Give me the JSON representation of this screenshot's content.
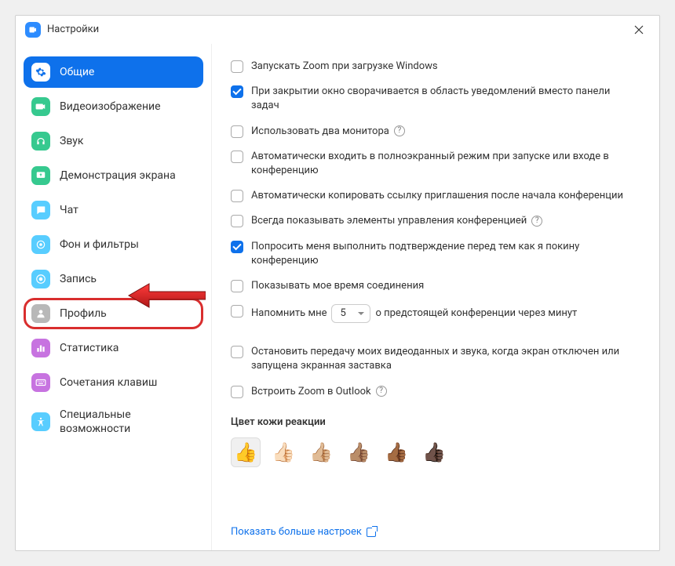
{
  "window": {
    "title": "Настройки"
  },
  "sidebar": {
    "items": [
      {
        "id": "general",
        "label": "Общие",
        "iconClass": "ic-general",
        "icon": "gear",
        "selected": true
      },
      {
        "id": "video",
        "label": "Видеоизображение",
        "iconClass": "ic-video",
        "icon": "video"
      },
      {
        "id": "audio",
        "label": "Звук",
        "iconClass": "ic-audio",
        "icon": "headphones"
      },
      {
        "id": "share",
        "label": "Демонстрация экрана",
        "iconClass": "ic-share",
        "icon": "share"
      },
      {
        "id": "chat",
        "label": "Чат",
        "iconClass": "ic-chat",
        "icon": "chat"
      },
      {
        "id": "background",
        "label": "Фон и фильтры",
        "iconClass": "ic-bg",
        "icon": "sparkle"
      },
      {
        "id": "record",
        "label": "Запись",
        "iconClass": "ic-record",
        "icon": "record"
      },
      {
        "id": "profile",
        "label": "Профиль",
        "iconClass": "ic-profile",
        "icon": "user",
        "highlighted": true
      },
      {
        "id": "stats",
        "label": "Статистика",
        "iconClass": "ic-stats",
        "icon": "stats"
      },
      {
        "id": "keyboard",
        "label": "Сочетания клавиш",
        "iconClass": "ic-keyboard",
        "icon": "keyboard"
      },
      {
        "id": "access",
        "label": "Специальные возможности",
        "iconClass": "ic-access",
        "icon": "access"
      }
    ]
  },
  "settings": {
    "items": [
      {
        "label": "Запускать Zoom при загрузке Windows",
        "checked": false,
        "help": false
      },
      {
        "label": "При закрытии окно сворачивается в область уведомлений вместо панели задач",
        "checked": true,
        "help": false
      },
      {
        "label": "Использовать два монитора",
        "checked": false,
        "help": true
      },
      {
        "label": "Автоматически входить в полноэкранный режим при запуске или входе в конференцию",
        "checked": false,
        "help": false
      },
      {
        "label": "Автоматически копировать ссылку приглашения после начала конференции",
        "checked": false,
        "help": false
      },
      {
        "label": "Всегда показывать элементы управления конференцией",
        "checked": false,
        "help": true
      },
      {
        "label": "Попросить меня выполнить подтверждение перед тем как я покину конференцию",
        "checked": true,
        "help": false
      },
      {
        "label": "Показывать мое время соединения",
        "checked": false,
        "help": false
      },
      {
        "label_pre": "Напомнить мне",
        "label_post": "о предстоящей конференции через минут",
        "checked": false,
        "select_value": "5",
        "is_remind": true
      },
      {
        "label": "Остановить передачу моих видеоданных и звука, когда экран отключен или запущена экранная заставка",
        "checked": false,
        "help": false,
        "gap_before": true
      },
      {
        "label": "Встроить Zoom в Outlook",
        "checked": false,
        "help": true
      }
    ],
    "skin_section_title": "Цвет кожи реакции",
    "skin_tones": [
      {
        "emoji": "👍",
        "selected": true
      },
      {
        "emoji": "👍🏻",
        "selected": false
      },
      {
        "emoji": "👍🏼",
        "selected": false
      },
      {
        "emoji": "👍🏽",
        "selected": false
      },
      {
        "emoji": "👍🏾",
        "selected": false
      },
      {
        "emoji": "👍🏿",
        "selected": false
      }
    ],
    "more_link": "Показать больше настроек"
  }
}
